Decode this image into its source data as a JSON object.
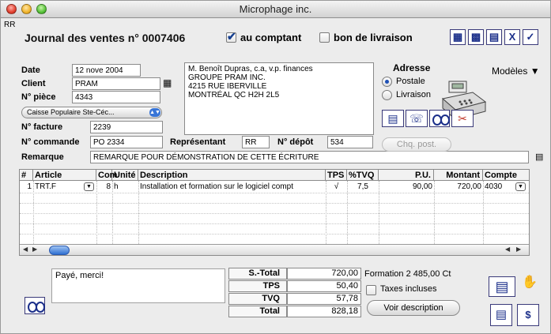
{
  "window": {
    "title": "Microphage inc.",
    "corner_label": "RR"
  },
  "heading": "Journal des ventes n° 0007406",
  "options": {
    "au_comptant": {
      "label": "au comptant",
      "checked": true
    },
    "bon_livraison": {
      "label": "bon de livraison",
      "checked": false
    }
  },
  "toolbar_icons": [
    "list-icon",
    "list-alt-icon",
    "print-icon",
    "delete-icon",
    "confirm-icon"
  ],
  "form": {
    "date_label": "Date",
    "date_value": "12 nove 2004",
    "client_label": "Client",
    "client_value": "PRAM",
    "piece_label": "N° pièce",
    "piece_value": "4343",
    "caisse_value": "Caisse Populaire Ste-Céc...",
    "facture_label": "N° facture",
    "facture_value": "2239",
    "commande_label": "N° commande",
    "commande_value": "PO 2334",
    "representant_label": "Représentant",
    "representant_value": "RR",
    "depot_label": "N° dépôt",
    "depot_value": "534",
    "remarque_label": "Remarque",
    "remarque_value": "REMARQUE POUR DÉMONSTRATION DE CETTE ÉCRITURE"
  },
  "address": {
    "lines": [
      "M. Benoît Dupras, c.a, v.p. finances",
      "GROUPE PRAM INC.",
      "4215 RUE IBERVILLE",
      "MONTRÉAL QC  H2H 2L5"
    ]
  },
  "adresse_box": {
    "title": "Adresse",
    "options": [
      {
        "label": "Postale",
        "selected": true
      },
      {
        "label": "Livraison",
        "selected": false
      }
    ]
  },
  "modeles": {
    "label": "Modèles"
  },
  "cheque_button": "Chq. post.",
  "grid": {
    "columns": [
      "#",
      "Article",
      "Com",
      "Unité",
      "Description",
      "TPS",
      "%TVQ",
      "P.U.",
      "Montant",
      "Compte"
    ],
    "rows": [
      {
        "num": "1",
        "article": "TRT.F",
        "com": "8",
        "unite": "h",
        "description": "Installation et formation sur le logiciel compt",
        "tps": "√",
        "tvq": "7,5",
        "pu": "90,00",
        "montant": "720,00",
        "compte": "4030"
      }
    ]
  },
  "footer": {
    "note": "Payé, merci!",
    "totals": [
      {
        "label": "S.-Total",
        "value": "720,00"
      },
      {
        "label": "TPS",
        "value": "50,40"
      },
      {
        "label": "TVQ",
        "value": "57,78"
      },
      {
        "label": "Total",
        "value": "828,18"
      }
    ],
    "formation": "Formation 2 485,00 Ct",
    "taxes_incluses": {
      "label": "Taxes incluses",
      "checked": false
    },
    "voir_description": "Voir description"
  }
}
